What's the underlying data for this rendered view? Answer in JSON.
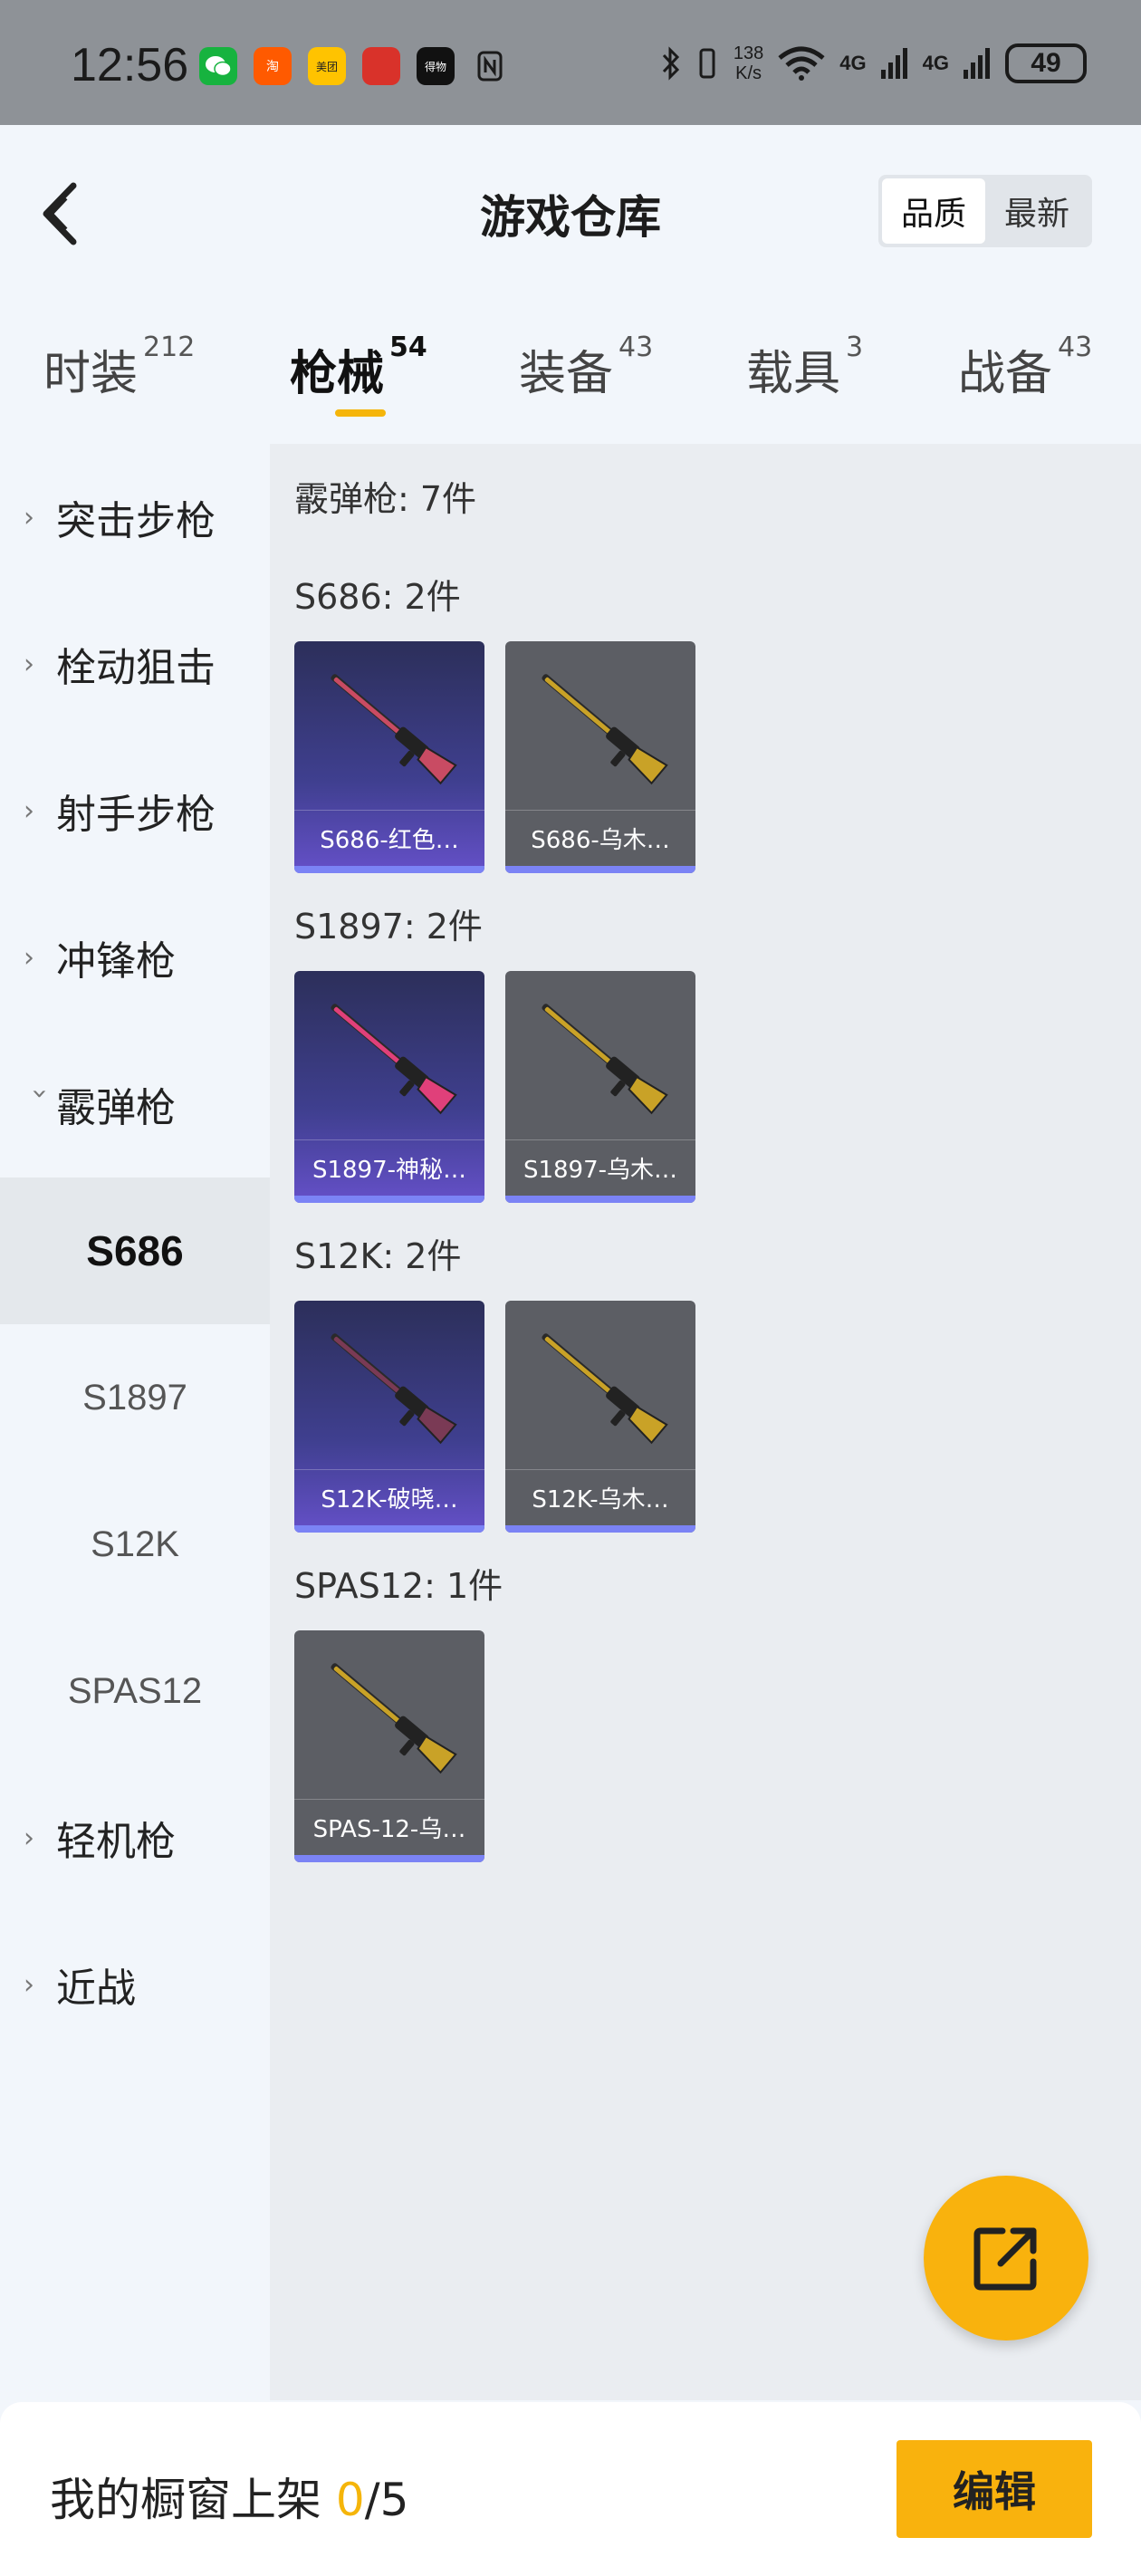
{
  "status_bar": {
    "time": "12:56",
    "apps": [
      {
        "icon": "wechat-icon",
        "color": "#17b33f",
        "label": ""
      },
      {
        "icon": "taobao-icon",
        "color": "#ff5a00",
        "label": "淘"
      },
      {
        "icon": "meituan-icon",
        "color": "#ffc300",
        "label": "美团"
      },
      {
        "icon": "game-app-icon",
        "color": "#d9322a",
        "label": ""
      },
      {
        "icon": "dewu-icon",
        "color": "#111111",
        "label": "得物"
      },
      {
        "icon": "nfc-icon",
        "color": "transparent",
        "label": ""
      }
    ],
    "net_speed_value": "138",
    "net_speed_unit": "K/s",
    "network": "4G",
    "battery": "49"
  },
  "header": {
    "title": "游戏仓库",
    "sort_options": [
      "品质",
      "最新"
    ],
    "sort_active": "品质"
  },
  "tabs": [
    {
      "label": "时装",
      "count": "212"
    },
    {
      "label": "枪械",
      "count": "54",
      "active": true
    },
    {
      "label": "装备",
      "count": "43"
    },
    {
      "label": "载具",
      "count": "3"
    },
    {
      "label": "战备",
      "count": "43"
    }
  ],
  "sidebar": {
    "categories": [
      "突击步枪",
      "栓动狙击",
      "射手步枪",
      "冲锋枪",
      "霰弹枪",
      "轻机枪",
      "近战"
    ],
    "expanded": "霰弹枪",
    "subitems": [
      "S686",
      "S1897",
      "S12K",
      "SPAS12"
    ],
    "active_sub": "S686"
  },
  "content": {
    "summary": "霰弹枪: 7件",
    "groups": [
      {
        "title": "S686: 2件",
        "items": [
          {
            "name": "S686-红色…",
            "rarity": "purple",
            "gun_color": "#c94b63"
          },
          {
            "name": "S686-乌木…",
            "rarity": "gray",
            "gun_color": "#c9a227"
          }
        ]
      },
      {
        "title": "S1897: 2件",
        "items": [
          {
            "name": "S1897-神秘…",
            "rarity": "purple",
            "gun_color": "#e0407a"
          },
          {
            "name": "S1897-乌木…",
            "rarity": "gray",
            "gun_color": "#c9a227"
          }
        ]
      },
      {
        "title": "S12K: 2件",
        "items": [
          {
            "name": "S12K-破晓…",
            "rarity": "purple",
            "gun_color": "#7a3a55"
          },
          {
            "name": "S12K-乌木…",
            "rarity": "gray",
            "gun_color": "#c9a227"
          }
        ]
      },
      {
        "title": "SPAS12: 1件",
        "items": [
          {
            "name": "SPAS-12-乌…",
            "rarity": "gray",
            "gun_color": "#c9a227"
          }
        ]
      }
    ]
  },
  "bottom": {
    "label": "我的橱窗上架 ",
    "count": "0",
    "total": "/5",
    "edit_label": "编辑"
  },
  "colors": {
    "accent": "#f9b20d",
    "rarity_bar": "#7b83f5"
  }
}
